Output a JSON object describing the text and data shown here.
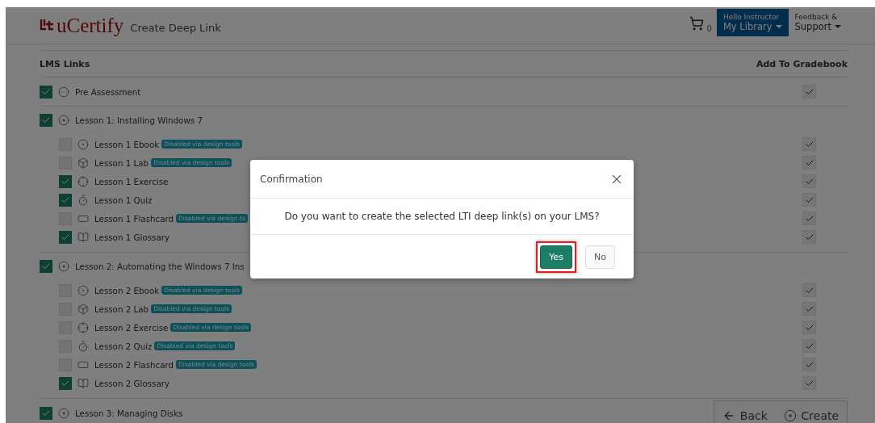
{
  "header": {
    "logo": "uCertify",
    "title": "Create Deep Link",
    "cart_count": "0",
    "account": {
      "greeting": "Hello Instructor",
      "label": "My Library"
    },
    "support": {
      "line1": "Feedback &",
      "line2": "Support"
    }
  },
  "table": {
    "columns": [
      "LMS Links",
      "Add To Gradebook"
    ],
    "items": [
      {
        "kind": "assessment",
        "title": "Pre Assessment",
        "checked": true,
        "gradebook": {
          "checked": true
        }
      },
      {
        "kind": "lesson",
        "title": "Lesson 1: Installing Windows 7",
        "checked": true,
        "children": [
          {
            "kind": "ebook",
            "title": "Lesson 1 Ebook",
            "checked": false,
            "badge": "Disabled via design tools",
            "gradebook": {
              "checked": true
            }
          },
          {
            "kind": "lab",
            "title": "Lesson 1 Lab",
            "checked": false,
            "badge": "Disabled via design tools",
            "gradebook": {
              "checked": true
            }
          },
          {
            "kind": "exercise",
            "title": "Lesson 1 Exercise",
            "checked": true,
            "gradebook": {
              "checked": true
            }
          },
          {
            "kind": "quiz",
            "title": "Lesson 1 Quiz",
            "checked": true,
            "gradebook": {
              "checked": true
            }
          },
          {
            "kind": "flashcard",
            "title": "Lesson 1 Flashcard",
            "checked": false,
            "badge": "Disabled via design to",
            "gradebook": {
              "checked": true
            }
          },
          {
            "kind": "glossary",
            "title": "Lesson 1 Glossary",
            "checked": true,
            "gradebook": {
              "checked": true
            }
          }
        ]
      },
      {
        "kind": "lesson",
        "title": "Lesson 2: Automating the Windows 7 Ins",
        "checked": true,
        "children": [
          {
            "kind": "ebook",
            "title": "Lesson 2 Ebook",
            "checked": false,
            "badge": "Disabled via design tools",
            "gradebook": {
              "checked": true
            }
          },
          {
            "kind": "lab",
            "title": "Lesson 2 Lab",
            "checked": false,
            "badge": "Disabled via design tools",
            "gradebook": {
              "checked": true
            }
          },
          {
            "kind": "exercise",
            "title": "Lesson 2 Exercise",
            "checked": false,
            "badge": "Disabled via design tools",
            "gradebook": {
              "checked": true
            }
          },
          {
            "kind": "quiz",
            "title": "Lesson 2 Quiz",
            "checked": false,
            "badge": "Disabled via design tools",
            "gradebook": {
              "checked": true
            }
          },
          {
            "kind": "flashcard",
            "title": "Lesson 2 Flashcard",
            "checked": false,
            "badge": "Disabled via design tools",
            "gradebook": {
              "checked": true
            }
          },
          {
            "kind": "glossary",
            "title": "Lesson 2 Glossary",
            "checked": true,
            "gradebook": {
              "checked": true
            }
          }
        ]
      },
      {
        "kind": "lesson",
        "title": "Lesson 3: Managing Disks",
        "checked": true
      }
    ]
  },
  "footer_buttons": [
    {
      "kind": "back",
      "label": "Back"
    },
    {
      "kind": "create",
      "label": "Create"
    }
  ],
  "dialog": {
    "title": "Confirmation",
    "message": "Do you want to create the selected LTI deep link(s) on your LMS?",
    "buttons": [
      {
        "kind": "primary",
        "label": "Yes",
        "highlighted": true
      },
      {
        "kind": "secondary",
        "label": "No",
        "highlighted": false
      }
    ]
  }
}
